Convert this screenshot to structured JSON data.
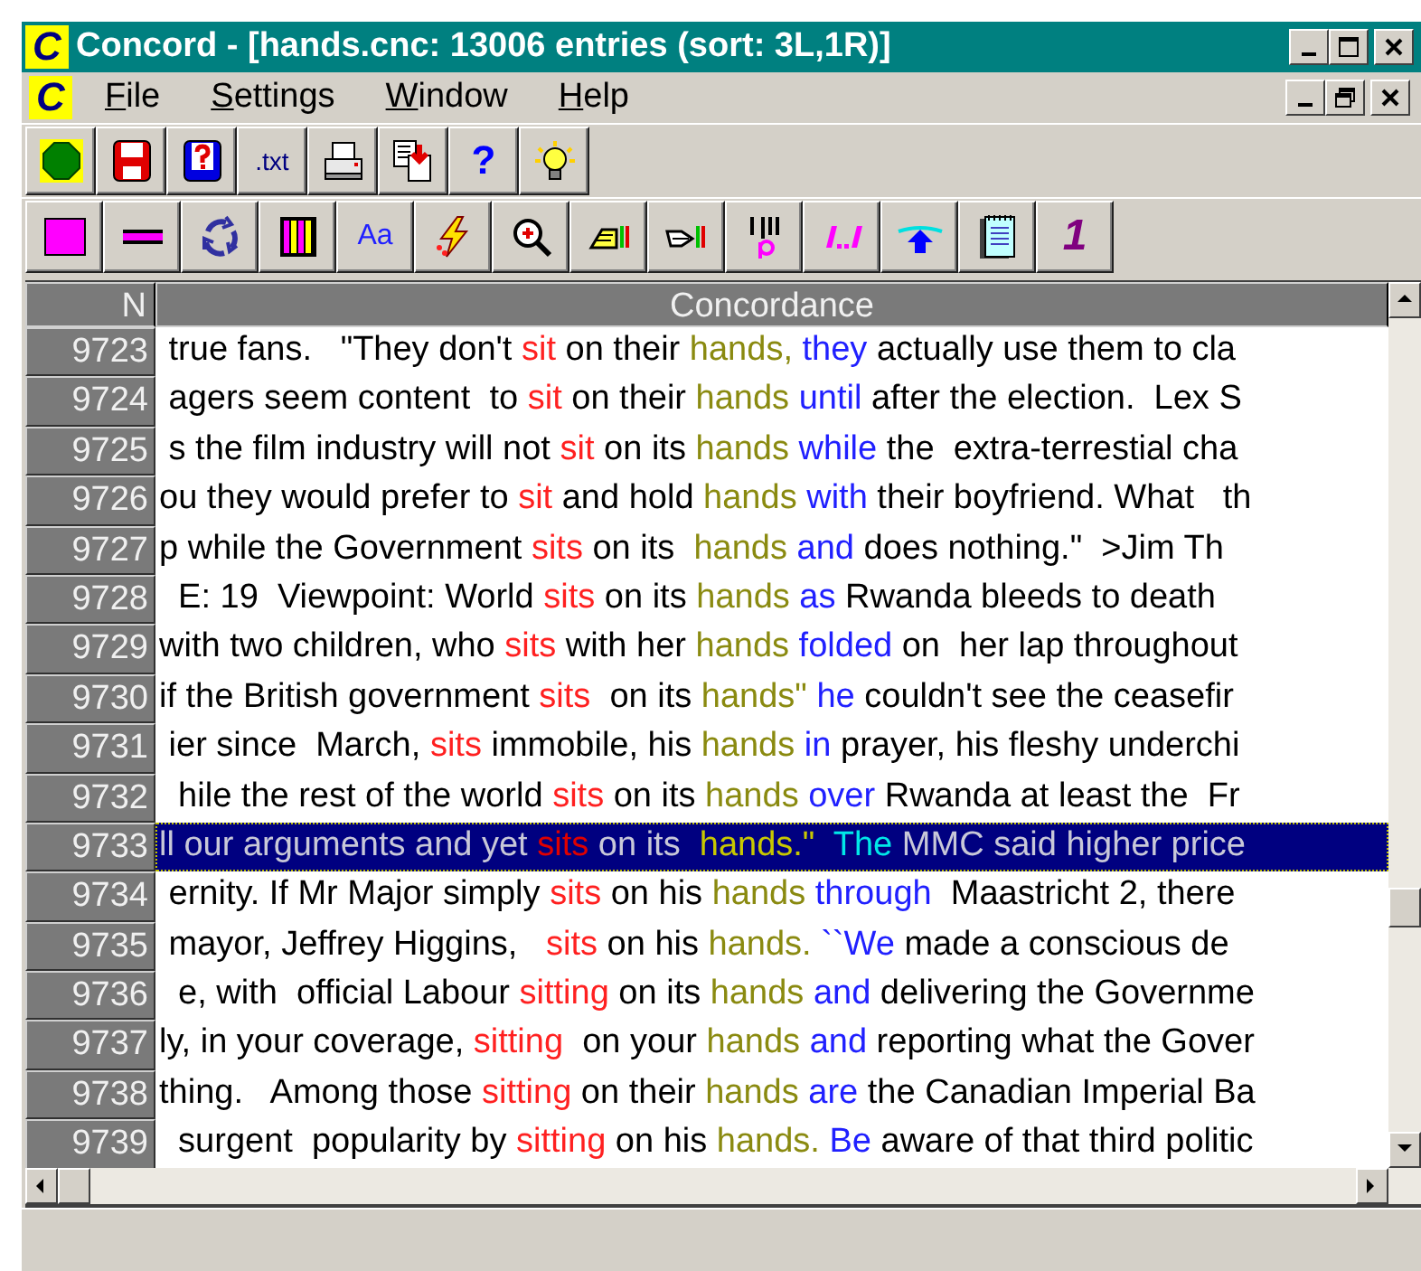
{
  "window": {
    "icon_letter": "C",
    "title": "Concord - [hands.cnc: 13006 entries (sort: 3L,1R)]"
  },
  "menu": {
    "icon_letter": "C",
    "items": [
      {
        "mnemonic": "F",
        "rest": "ile"
      },
      {
        "mnemonic": "S",
        "rest": "ettings"
      },
      {
        "mnemonic": "W",
        "rest": "indow"
      },
      {
        "mnemonic": "H",
        "rest": "elp"
      }
    ]
  },
  "toolbar_1": [
    {
      "kind": "icon"
    },
    {
      "kind": "icon"
    },
    {
      "kind": "icon"
    },
    {
      "kind": "text",
      "label": ".txt"
    },
    {
      "kind": "icon"
    },
    {
      "kind": "icon"
    },
    {
      "kind": "text",
      "label": "?"
    },
    {
      "kind": "icon"
    }
  ],
  "toolbar_2": [
    {
      "kind": "icon"
    },
    {
      "kind": "icon"
    },
    {
      "kind": "icon"
    },
    {
      "kind": "icon"
    },
    {
      "kind": "text",
      "label": "Aa"
    },
    {
      "kind": "icon"
    },
    {
      "kind": "icon"
    },
    {
      "kind": "icon"
    },
    {
      "kind": "icon"
    },
    {
      "kind": "icon"
    },
    {
      "kind": "icon"
    },
    {
      "kind": "icon"
    },
    {
      "kind": "icon"
    },
    {
      "kind": "text",
      "label": "1"
    }
  ],
  "table": {
    "columns": [
      "N",
      "Concordance"
    ],
    "rows": [
      {
        "n": "9723",
        "selected": false,
        "segments": [
          {
            "kind": "plain",
            "text": " true fans.   \"They don't "
          },
          {
            "kind": "search",
            "text": "sit"
          },
          {
            "kind": "plain",
            "text": " on their "
          },
          {
            "kind": "context",
            "text": "hands,"
          },
          {
            "kind": "collocate",
            "text": " they"
          },
          {
            "kind": "plain",
            "text": " actually use them to cla"
          }
        ]
      },
      {
        "n": "9724",
        "selected": false,
        "segments": [
          {
            "kind": "plain",
            "text": " agers seem content  to "
          },
          {
            "kind": "search",
            "text": "sit"
          },
          {
            "kind": "plain",
            "text": " on their "
          },
          {
            "kind": "context",
            "text": "hands"
          },
          {
            "kind": "collocate",
            "text": " until"
          },
          {
            "kind": "plain",
            "text": " after the election.  Lex S"
          }
        ]
      },
      {
        "n": "9725",
        "selected": false,
        "segments": [
          {
            "kind": "plain",
            "text": " s the film industry will not "
          },
          {
            "kind": "search",
            "text": "sit"
          },
          {
            "kind": "plain",
            "text": " on its "
          },
          {
            "kind": "context",
            "text": "hands"
          },
          {
            "kind": "collocate",
            "text": " while"
          },
          {
            "kind": "plain",
            "text": " the  extra-terrestial cha"
          }
        ]
      },
      {
        "n": "9726",
        "selected": false,
        "segments": [
          {
            "kind": "plain",
            "text": "ou they would prefer to "
          },
          {
            "kind": "search",
            "text": "sit"
          },
          {
            "kind": "plain",
            "text": " and hold "
          },
          {
            "kind": "context",
            "text": "hands"
          },
          {
            "kind": "collocate",
            "text": " with"
          },
          {
            "kind": "plain",
            "text": " their boyfriend. What   th"
          }
        ]
      },
      {
        "n": "9727",
        "selected": false,
        "segments": [
          {
            "kind": "plain",
            "text": "p while the Government "
          },
          {
            "kind": "search",
            "text": "sits"
          },
          {
            "kind": "plain",
            "text": " on its  "
          },
          {
            "kind": "context",
            "text": "hands"
          },
          {
            "kind": "collocate",
            "text": " and"
          },
          {
            "kind": "plain",
            "text": " does nothing.\"  >Jim Th"
          }
        ]
      },
      {
        "n": "9728",
        "selected": false,
        "segments": [
          {
            "kind": "plain",
            "text": "  E: 19  Viewpoint: World "
          },
          {
            "kind": "search",
            "text": "sits"
          },
          {
            "kind": "plain",
            "text": " on its "
          },
          {
            "kind": "context",
            "text": "hands"
          },
          {
            "kind": "collocate",
            "text": " as"
          },
          {
            "kind": "plain",
            "text": " Rwanda bleeds to death"
          }
        ]
      },
      {
        "n": "9729",
        "selected": false,
        "segments": [
          {
            "kind": "plain",
            "text": "with two children, who "
          },
          {
            "kind": "search",
            "text": "sits"
          },
          {
            "kind": "plain",
            "text": " with her "
          },
          {
            "kind": "context",
            "text": "hands"
          },
          {
            "kind": "collocate",
            "text": " folded"
          },
          {
            "kind": "plain",
            "text": " on  her lap throughout"
          }
        ]
      },
      {
        "n": "9730",
        "selected": false,
        "segments": [
          {
            "kind": "plain",
            "text": "if the British government "
          },
          {
            "kind": "search",
            "text": "sits"
          },
          {
            "kind": "plain",
            "text": "  on its "
          },
          {
            "kind": "context",
            "text": "hands\""
          },
          {
            "kind": "collocate",
            "text": " he"
          },
          {
            "kind": "plain",
            "text": " couldn't see the ceasefir"
          }
        ]
      },
      {
        "n": "9731",
        "selected": false,
        "segments": [
          {
            "kind": "plain",
            "text": " ier since  March, "
          },
          {
            "kind": "search",
            "text": "sits"
          },
          {
            "kind": "plain",
            "text": " immobile, his "
          },
          {
            "kind": "context",
            "text": "hands"
          },
          {
            "kind": "collocate",
            "text": " in"
          },
          {
            "kind": "plain",
            "text": " prayer, his fleshy underchi"
          }
        ]
      },
      {
        "n": "9732",
        "selected": false,
        "segments": [
          {
            "kind": "plain",
            "text": "  hile the rest of the world "
          },
          {
            "kind": "search",
            "text": "sits"
          },
          {
            "kind": "plain",
            "text": " on its "
          },
          {
            "kind": "context",
            "text": "hands"
          },
          {
            "kind": "collocate",
            "text": " over"
          },
          {
            "kind": "plain",
            "text": " Rwanda at least the  Fr"
          }
        ]
      },
      {
        "n": "9733",
        "selected": true,
        "segments": [
          {
            "kind": "plain",
            "text": "ll our arguments and yet "
          },
          {
            "kind": "search",
            "text": "sits"
          },
          {
            "kind": "plain",
            "text": " on its  "
          },
          {
            "kind": "context",
            "text": "hands.\""
          },
          {
            "kind": "collocate",
            "text": "  The"
          },
          {
            "kind": "plain",
            "text": " MMC said higher price"
          }
        ]
      },
      {
        "n": "9734",
        "selected": false,
        "segments": [
          {
            "kind": "plain",
            "text": " ernity. If Mr Major simply "
          },
          {
            "kind": "search",
            "text": "sits"
          },
          {
            "kind": "plain",
            "text": " on his "
          },
          {
            "kind": "context",
            "text": "hands"
          },
          {
            "kind": "collocate",
            "text": " through"
          },
          {
            "kind": "plain",
            "text": "  Maastricht 2, there"
          }
        ]
      },
      {
        "n": "9735",
        "selected": false,
        "segments": [
          {
            "kind": "plain",
            "text": " mayor, Jeffrey Higgins,   "
          },
          {
            "kind": "search",
            "text": "sits"
          },
          {
            "kind": "plain",
            "text": " on his "
          },
          {
            "kind": "context",
            "text": "hands."
          },
          {
            "kind": "collocate",
            "text": " ``We"
          },
          {
            "kind": "plain",
            "text": " made a conscious de"
          }
        ]
      },
      {
        "n": "9736",
        "selected": false,
        "segments": [
          {
            "kind": "plain",
            "text": "  e, with  official Labour "
          },
          {
            "kind": "search",
            "text": "sitting"
          },
          {
            "kind": "plain",
            "text": " on its "
          },
          {
            "kind": "context",
            "text": "hands"
          },
          {
            "kind": "collocate",
            "text": " and"
          },
          {
            "kind": "plain",
            "text": " delivering the Governme"
          }
        ]
      },
      {
        "n": "9737",
        "selected": false,
        "segments": [
          {
            "kind": "plain",
            "text": "ly, in your coverage, "
          },
          {
            "kind": "search",
            "text": "sitting"
          },
          {
            "kind": "plain",
            "text": "  on your "
          },
          {
            "kind": "context",
            "text": "hands"
          },
          {
            "kind": "collocate",
            "text": " and"
          },
          {
            "kind": "plain",
            "text": " reporting what the Gover"
          }
        ]
      },
      {
        "n": "9738",
        "selected": false,
        "segments": [
          {
            "kind": "plain",
            "text": "thing.   Among those "
          },
          {
            "kind": "search",
            "text": "sitting"
          },
          {
            "kind": "plain",
            "text": " on their "
          },
          {
            "kind": "context",
            "text": "hands"
          },
          {
            "kind": "collocate",
            "text": " are"
          },
          {
            "kind": "plain",
            "text": " the Canadian Imperial Ba"
          }
        ]
      },
      {
        "n": "9739",
        "selected": false,
        "segments": [
          {
            "kind": "plain",
            "text": "  surgent  popularity by "
          },
          {
            "kind": "search",
            "text": "sitting"
          },
          {
            "kind": "plain",
            "text": " on his "
          },
          {
            "kind": "context",
            "text": "hands."
          },
          {
            "kind": "collocate",
            "text": " Be"
          },
          {
            "kind": "plain",
            "text": " aware of that third politic"
          }
        ]
      }
    ]
  }
}
